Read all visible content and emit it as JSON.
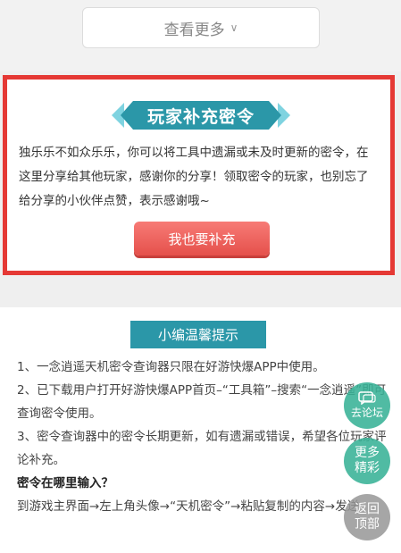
{
  "more": {
    "label": "查看更多"
  },
  "player_code": {
    "title": "玩家补充密令",
    "description": "独乐乐不如众乐乐，你可以将工具中遗漏或未及时更新的密令，在这里分享给其他玩家，感谢你的分享！领取密令的玩家，也别忘了给分享的小伙伴点赞，表示感谢哦~",
    "button": "我也要补充"
  },
  "tips": {
    "title": "小编温馨提示",
    "items": [
      "1、一念逍遥天机密令查询器只限在好游快爆APP中使用。",
      "2、已下载用户打开好游快爆APP首页–“工具箱”–搜索“一念逍遥”即可查询密令使用。",
      "3、密令查询器中的密令长期更新，如有遗漏或错误，希望各位玩家评论补充。"
    ],
    "question": "密令在哪里输入？",
    "answer": "到游戏主界面→左上角头像→“天机密令”→粘贴复制的内容→发送"
  },
  "floating": {
    "forum": "去论坛",
    "more": "更多精彩",
    "top": "返回顶部"
  },
  "colors": {
    "frame": "#e53935",
    "banner": "#2b97a8",
    "button": "#e5504b",
    "float_green": "#38b296"
  }
}
